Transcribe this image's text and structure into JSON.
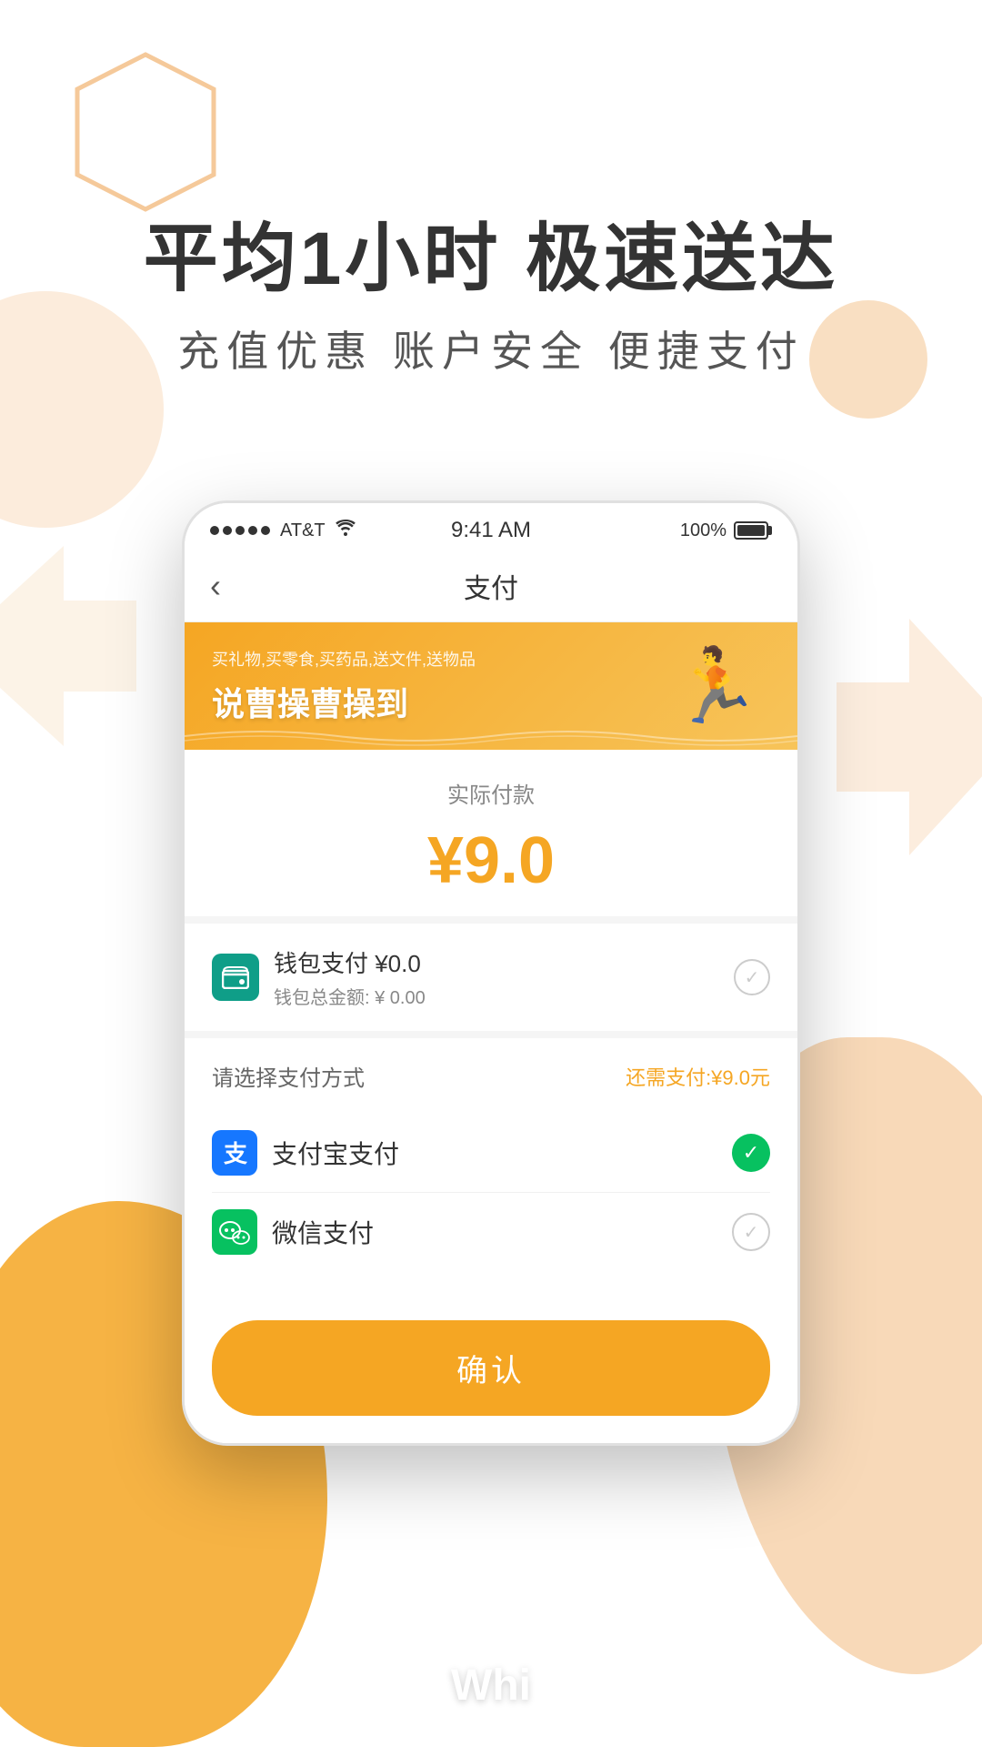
{
  "app": {
    "bg_color": "#ffffff",
    "accent_color": "#f5a623"
  },
  "header": {
    "main_title": "平均1小时 极速送达",
    "sub_title": "充值优惠   账户安全   便捷支付"
  },
  "status_bar": {
    "carrier": "AT&T",
    "time": "9:41 AM",
    "battery": "100%"
  },
  "nav": {
    "back_label": "‹",
    "title": "支付"
  },
  "banner": {
    "sub_text": "买礼物,买零食,买药品,送文件,送物品",
    "main_text": "说曹操曹操到"
  },
  "payment": {
    "label": "实际付款",
    "amount": "¥9.0",
    "amount_color": "#f5a623"
  },
  "wallet": {
    "icon_label": "💳",
    "title": "钱包支付 ¥0.0",
    "sub": "钱包总金额: ¥ 0.00"
  },
  "payment_methods": {
    "header_left": "请选择支付方式",
    "header_right": "还需支付:¥9.0元",
    "methods": [
      {
        "id": "alipay",
        "icon_label": "支",
        "name": "支付宝支付",
        "selected": true
      },
      {
        "id": "wechat",
        "icon_label": "微",
        "name": "微信支付",
        "selected": false
      }
    ]
  },
  "confirm_button": {
    "label": "确认"
  },
  "bottom_text": "Whi"
}
